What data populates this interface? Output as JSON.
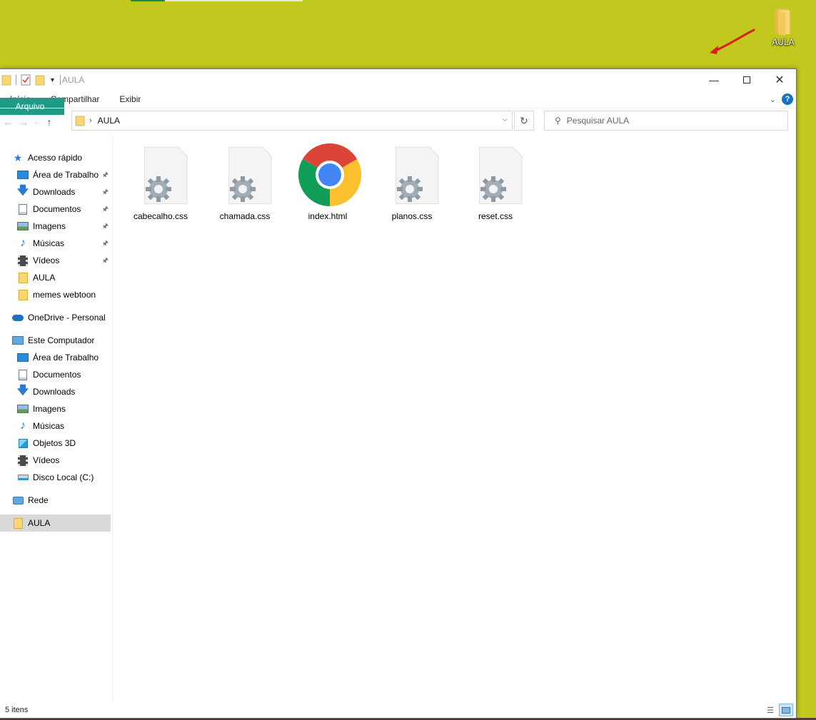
{
  "desktop": {
    "icon_label": "AULA"
  },
  "window": {
    "title": "AULA",
    "ribbon_tabs": [
      "Arquivo",
      "Início",
      "Compartilhar",
      "Exibir"
    ],
    "address": {
      "crumb": "AULA"
    },
    "search": {
      "placeholder": "Pesquisar AULA"
    },
    "nav": {
      "quick_access": "Acesso rápido",
      "quick_items": [
        {
          "label": "Área de Trabalho",
          "icon": "desktop-icon",
          "pinned": true
        },
        {
          "label": "Downloads",
          "icon": "download-icon",
          "pinned": true
        },
        {
          "label": "Documentos",
          "icon": "document-icon",
          "pinned": true
        },
        {
          "label": "Imagens",
          "icon": "pictures-icon",
          "pinned": true
        },
        {
          "label": "Músicas",
          "icon": "music-icon",
          "pinned": true
        },
        {
          "label": "Vídeos",
          "icon": "video-icon",
          "pinned": true
        },
        {
          "label": "AULA",
          "icon": "folder-icon",
          "pinned": false
        },
        {
          "label": "memes webtoon",
          "icon": "folder-icon",
          "pinned": false
        }
      ],
      "onedrive": "OneDrive - Personal",
      "this_pc": "Este Computador",
      "pc_items": [
        {
          "label": "Área de Trabalho",
          "icon": "desktop-icon"
        },
        {
          "label": "Documentos",
          "icon": "document-icon"
        },
        {
          "label": "Downloads",
          "icon": "download-icon"
        },
        {
          "label": "Imagens",
          "icon": "pictures-icon"
        },
        {
          "label": "Músicas",
          "icon": "music-icon"
        },
        {
          "label": "Objetos 3D",
          "icon": "cube-icon"
        },
        {
          "label": "Vídeos",
          "icon": "video-icon"
        },
        {
          "label": "Disco Local (C:)",
          "icon": "drive-icon"
        }
      ],
      "network": "Rede",
      "selected": "AULA"
    },
    "files": [
      {
        "name": "cabecalho.css",
        "icon": "css-file-icon"
      },
      {
        "name": "chamada.css",
        "icon": "css-file-icon"
      },
      {
        "name": "index.html",
        "icon": "chrome-icon"
      },
      {
        "name": "planos.css",
        "icon": "css-file-icon"
      },
      {
        "name": "reset.css",
        "icon": "css-file-icon"
      }
    ],
    "status": {
      "count": "5 itens"
    }
  },
  "colors": {
    "desktop_bg": "#c2c81e",
    "file_tab": "#1e9b85",
    "folder": "#f8d775",
    "selection": "#d9d9d9"
  }
}
